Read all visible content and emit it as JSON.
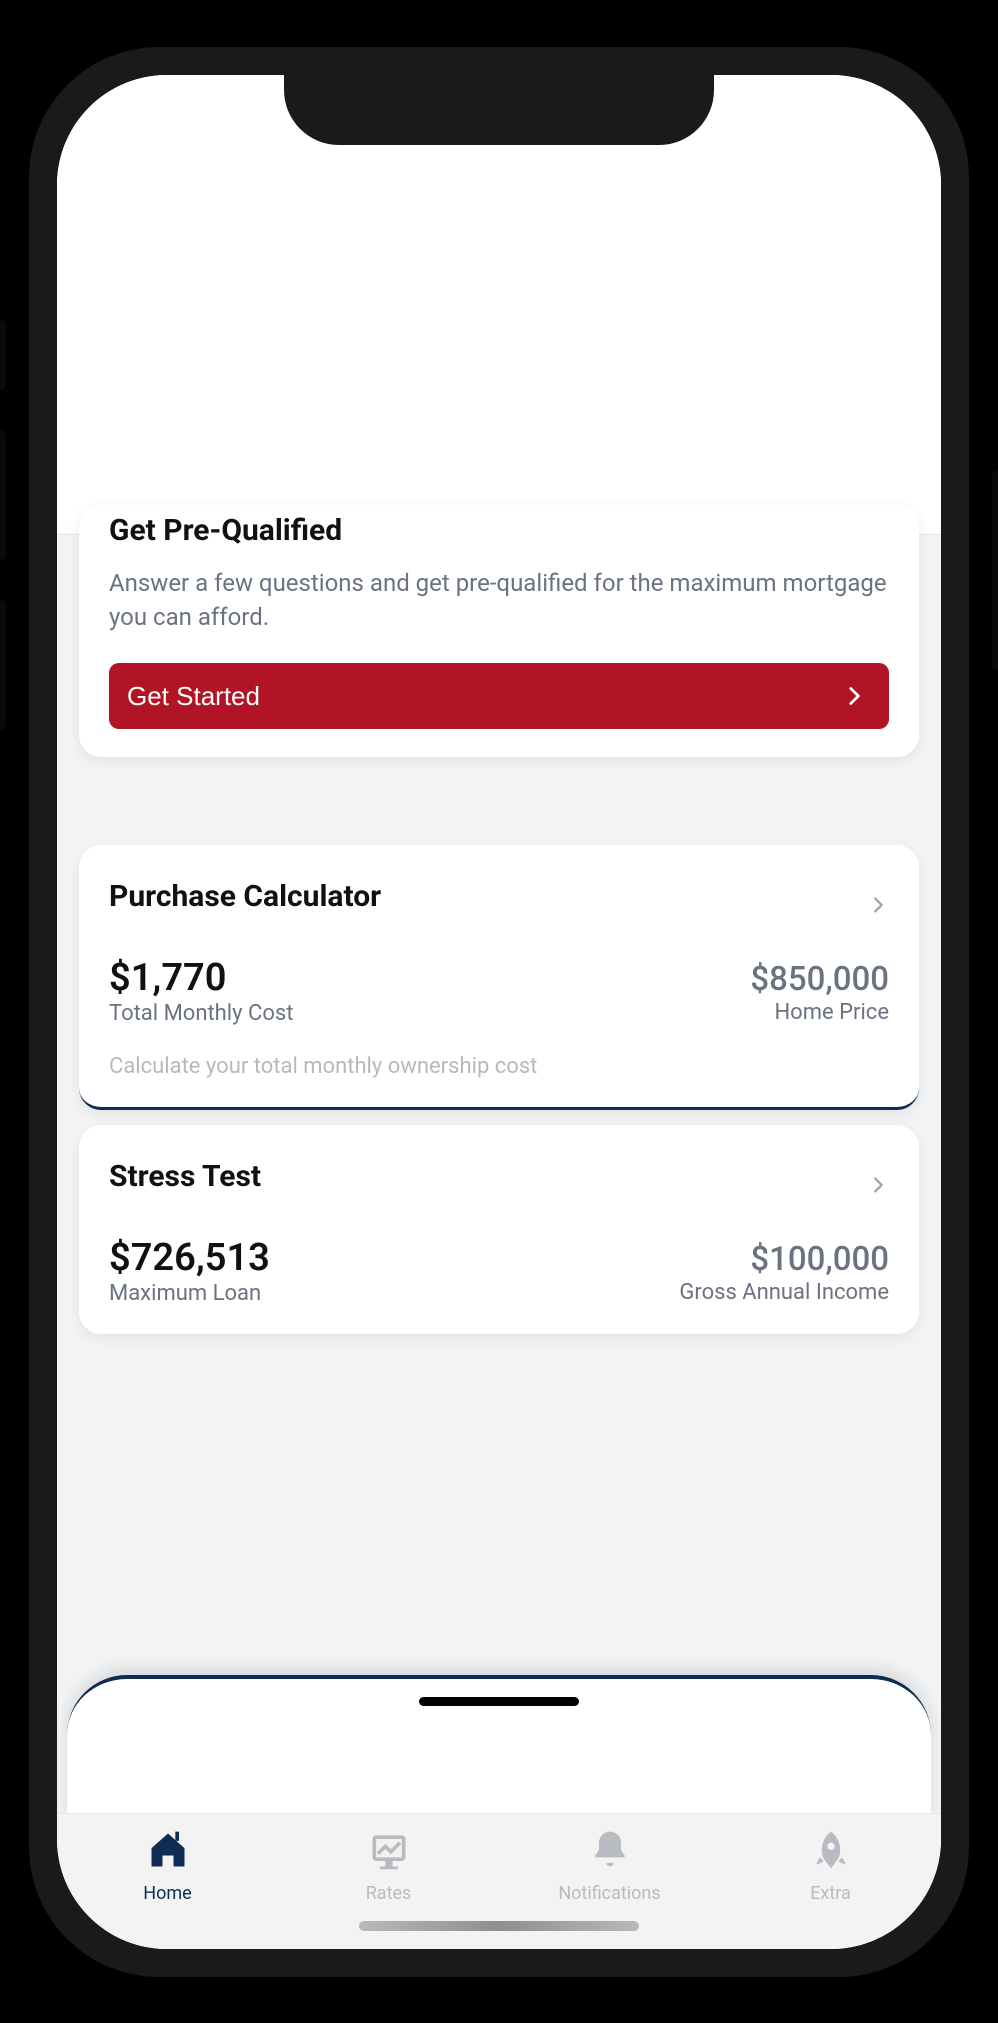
{
  "prequal": {
    "title": "Get Pre-Qualified",
    "subtitle": "Answer a few questions and get pre-qualified for the maximum mortgage you can afford.",
    "cta": "Get Started"
  },
  "purchase": {
    "title": "Purchase Calculator",
    "left_value": "$1,770",
    "left_label": "Total Monthly Cost",
    "right_value": "$850,000",
    "right_label": "Home Price",
    "footnote": "Calculate your total monthly ownership cost"
  },
  "stress": {
    "title": "Stress Test",
    "left_value": "$726,513",
    "left_label": "Maximum Loan",
    "right_value": "$100,000",
    "right_label": "Gross Annual Income"
  },
  "tabs": {
    "home": "Home",
    "rates": "Rates",
    "notifications": "Notifications",
    "extra": "Extra"
  }
}
